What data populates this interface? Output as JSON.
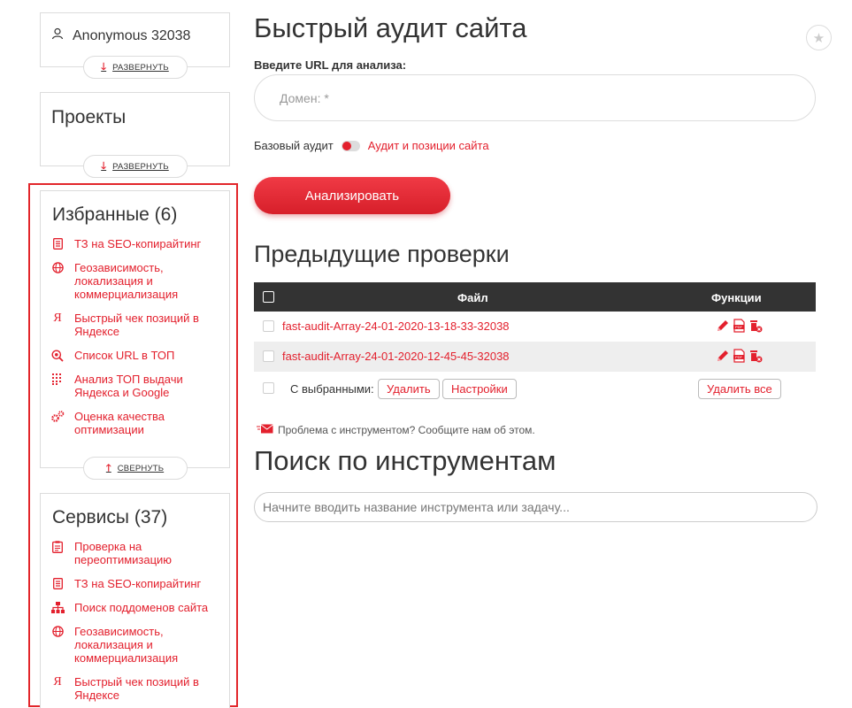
{
  "user": {
    "name": "Anonymous 32038"
  },
  "user_card": {
    "expand_label": "РАЗВЕРНУТЬ"
  },
  "projects": {
    "title": "Проекты",
    "expand_label": "РАЗВЕРНУТЬ"
  },
  "favorites": {
    "title": "Избранные (6)",
    "collapse_label": "СВЕРНУТЬ",
    "items": [
      {
        "label": "ТЗ на SEO-копирайтинг",
        "icon": "document-icon"
      },
      {
        "label": "Геозависимость, локализация и коммерциализация",
        "icon": "globe-icon"
      },
      {
        "label": "Быстрый чек позиций в Яндексе",
        "icon": "yandex-icon"
      },
      {
        "label": "Список URL в ТОП",
        "icon": "magnifier-icon"
      },
      {
        "label": "Анализ ТОП выдачи Яндекса и Google",
        "icon": "grid-icon"
      },
      {
        "label": "Оценка качества оптимизации",
        "icon": "gears-icon"
      }
    ]
  },
  "services": {
    "title": "Сервисы (37)",
    "items": [
      {
        "label": "Проверка на переоптимизацию",
        "icon": "checklist-icon"
      },
      {
        "label": "ТЗ на SEO-копирайтинг",
        "icon": "document-icon"
      },
      {
        "label": "Поиск поддоменов сайта",
        "icon": "sitemap-icon"
      },
      {
        "label": "Геозависимость, локализация и коммерциализация",
        "icon": "globe-icon"
      },
      {
        "label": "Быстрый чек позиций в Яндексе",
        "icon": "yandex-icon"
      }
    ]
  },
  "main": {
    "title": "Быстрый аудит сайта",
    "url_label": "Введите URL для анализа:",
    "url_placeholder": "Домен: *",
    "toggle_left": "Базовый аудит",
    "toggle_right": "Аудит и позиции сайта",
    "analyze_button": "Анализировать"
  },
  "previous": {
    "title": "Предыдущие проверки",
    "col_file": "Файл",
    "col_functions": "Функции",
    "rows": [
      {
        "file": "fast-audit-Array-24-01-2020-13-18-33-32038"
      },
      {
        "file": "fast-audit-Array-24-01-2020-12-45-45-32038"
      }
    ],
    "with_selected": "С выбранными:",
    "delete_button": "Удалить",
    "settings_button": "Настройки",
    "delete_all_button": "Удалить все"
  },
  "problem_text": "Проблема с инструментом? Сообщите нам об этом.",
  "search": {
    "title": "Поиск по инструментам",
    "placeholder": "Начните вводить название инструмента или задачу..."
  },
  "colors": {
    "accent": "#e3202d",
    "table_header": "#333333",
    "highlight": "#e2262b"
  }
}
